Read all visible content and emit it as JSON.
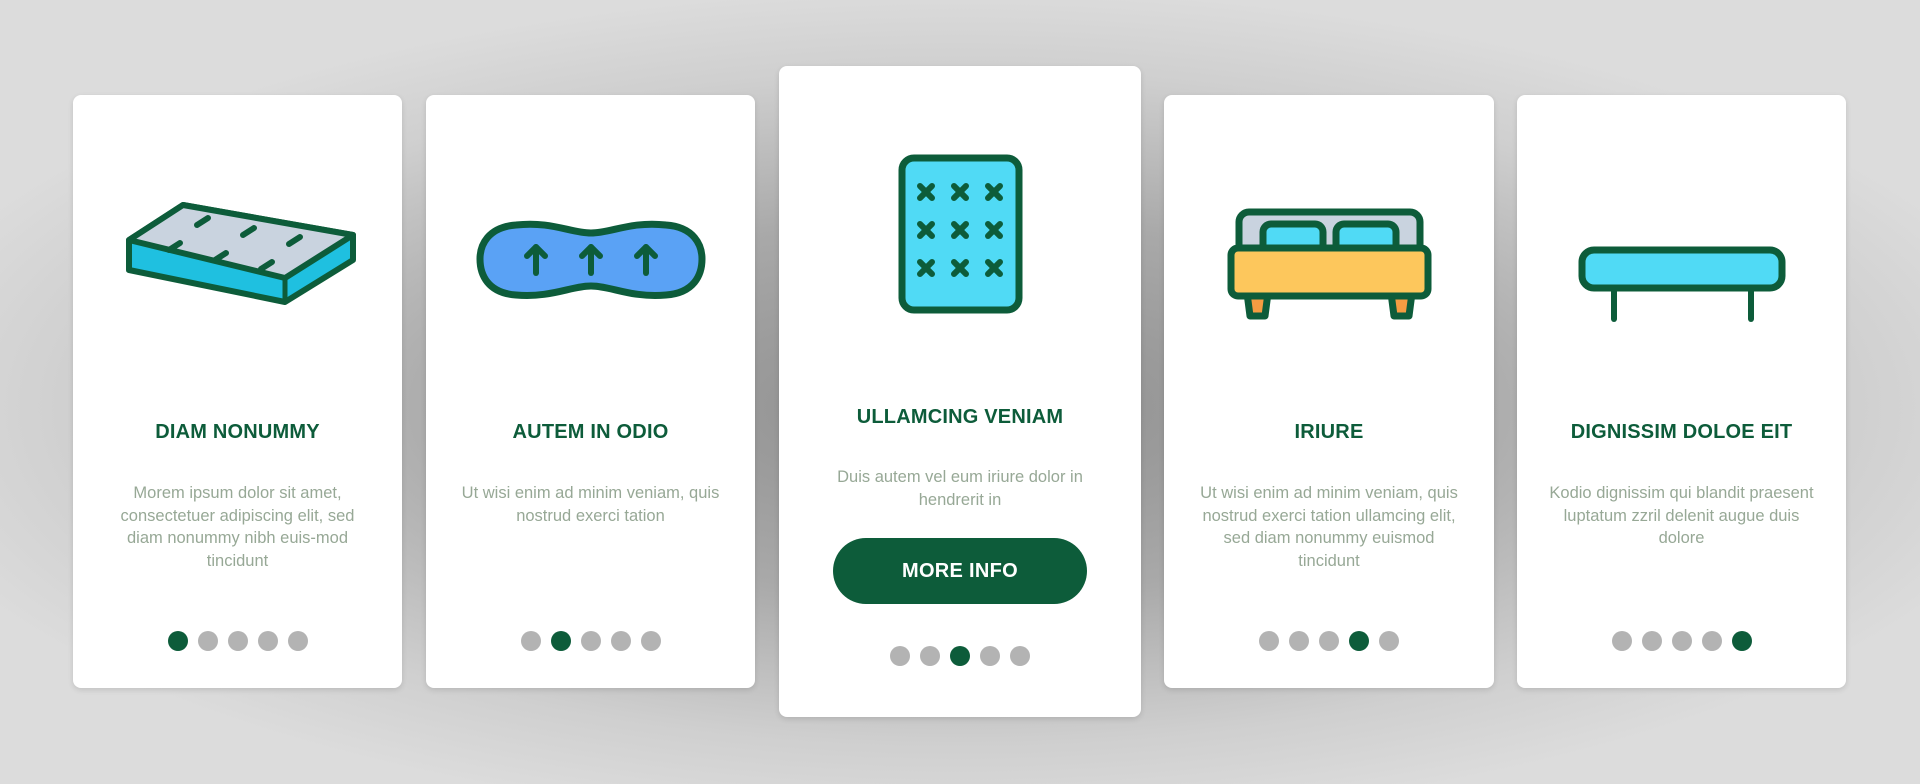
{
  "colors": {
    "primary": "#0d5c3a",
    "text_muted": "#97a896",
    "dot_inactive": "#b3b3b3",
    "card_bg": "#ffffff"
  },
  "cards": [
    {
      "icon": "mattress-icon",
      "title": "DIAM NONUMMY",
      "description": "Morem ipsum dolor sit amet, consectetuer adipiscing elit, sed diam nonummy nibh euis-mod tincidunt",
      "page_indicator": {
        "total": 5,
        "active": 1
      }
    },
    {
      "icon": "orthopedic-pillow-icon",
      "title": "AUTEM IN ODIO",
      "description": "Ut wisi enim ad minim veniam, quis nostrud exerci tation",
      "page_indicator": {
        "total": 5,
        "active": 2
      }
    },
    {
      "icon": "quilted-mattress-icon",
      "title": "ULLAMCING VENIAM",
      "description": "Duis autem vel eum iriure dolor in hendrerit in",
      "button_label": "MORE INFO",
      "page_indicator": {
        "total": 5,
        "active": 3
      }
    },
    {
      "icon": "double-bed-icon",
      "title": "IRIURE",
      "description": "Ut wisi enim ad minim veniam, quis nostrud exerci tation ullamcing elit, sed diam nonummy euismod tincidunt",
      "page_indicator": {
        "total": 5,
        "active": 4
      }
    },
    {
      "icon": "bench-mattress-icon",
      "title": "DIGNISSIM DOLOE EIT",
      "description": "Kodio dignissim qui blandit praesent luptatum zzril delenit augue duis dolore",
      "page_indicator": {
        "total": 5,
        "active": 5
      }
    }
  ]
}
